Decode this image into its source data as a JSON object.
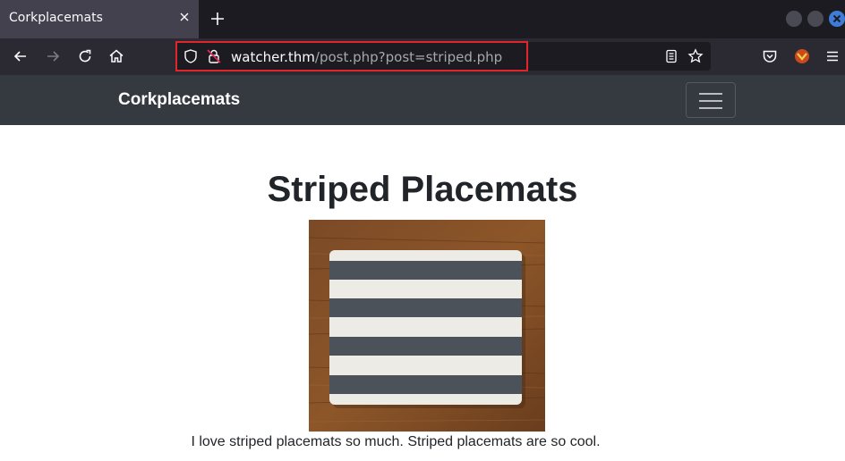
{
  "browser": {
    "tab": {
      "title": "Corkplacemats"
    },
    "url": {
      "domain": "watcher.thm",
      "path": "/post.php?post=striped.php"
    }
  },
  "site": {
    "brand": "Corkplacemats"
  },
  "post": {
    "title": "Striped Placemats",
    "image_alt": "striped placemat on wooden table",
    "body": "I love striped placemats so much. Striped placemats are so cool."
  },
  "colors": {
    "navbar": "#343a40",
    "url_highlight": "#e0252b",
    "chrome_bg": "#1c1b22",
    "toolbar_bg": "#2b2a33"
  }
}
